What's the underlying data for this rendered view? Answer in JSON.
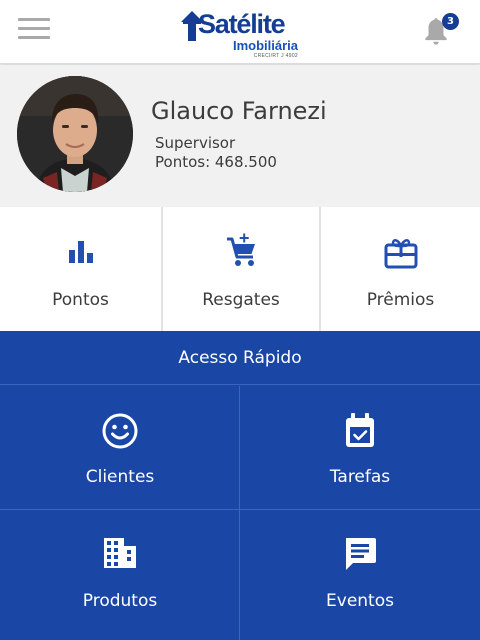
{
  "header": {
    "menu_icon": "hamburger-menu-icon",
    "logo": {
      "name": "Satélite",
      "subtitle": "Imobiliária",
      "creci": "CRECI/RT J 4902"
    },
    "notification_icon": "bell-icon",
    "notification_count": "3"
  },
  "profile": {
    "name": "Glauco Farnezi",
    "role": "Supervisor",
    "points": "Pontos: 468.500"
  },
  "shortcuts": [
    {
      "label": "Pontos",
      "icon": "bar-chart-icon"
    },
    {
      "label": "Resgates",
      "icon": "add-to-cart-icon"
    },
    {
      "label": "Prêmios",
      "icon": "gift-card-icon"
    }
  ],
  "quick_access": {
    "title": "Acesso Rápido",
    "items": [
      {
        "label": "Clientes",
        "icon": "smiley-face-icon"
      },
      {
        "label": "Tarefas",
        "icon": "calendar-check-icon"
      },
      {
        "label": "Produtos",
        "icon": "building-icon"
      },
      {
        "label": "Eventos",
        "icon": "chat-message-icon"
      }
    ]
  },
  "colors": {
    "primary": "#1a46a6",
    "logo_blue": "#143d93",
    "icon_blue": "#2350b0",
    "header_bg": "#ffffff",
    "profile_bg": "#f1f1f1"
  }
}
